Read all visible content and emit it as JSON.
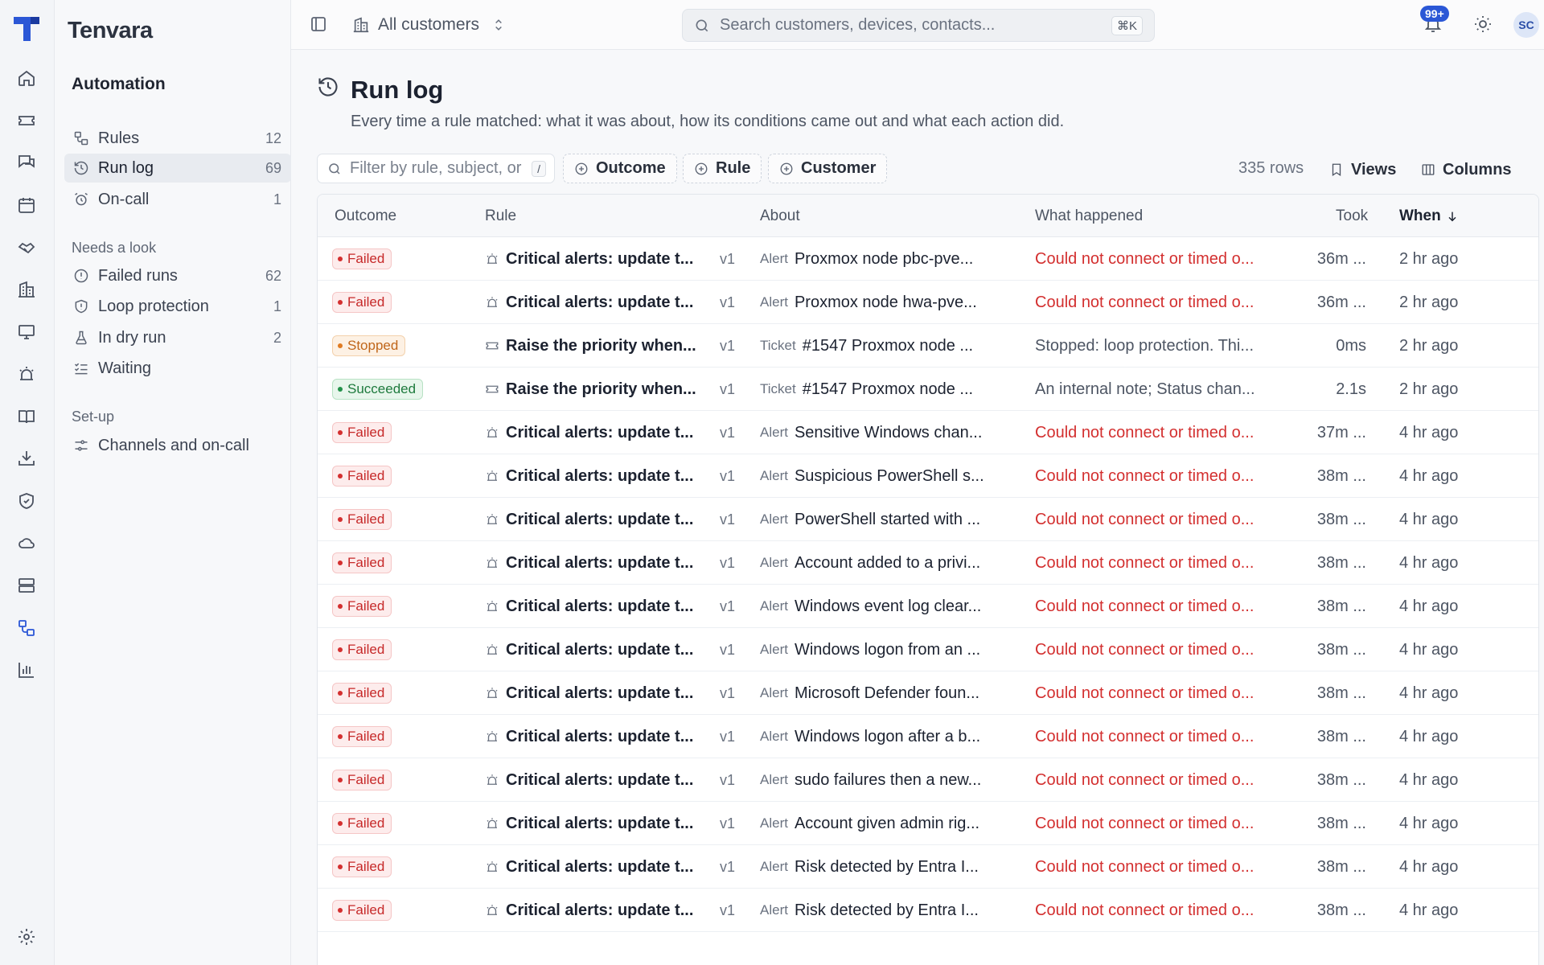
{
  "brand": "Tenvara",
  "sidebar": {
    "title": "Automation",
    "items": [
      {
        "label": "Rules",
        "count": "12",
        "icon": "rules-icon"
      },
      {
        "label": "Run log",
        "count": "69",
        "icon": "history-icon"
      },
      {
        "label": "On-call",
        "count": "1",
        "icon": "alarm-clock-icon"
      }
    ],
    "needs_look": {
      "title": "Needs a look",
      "items": [
        {
          "label": "Failed runs",
          "count": "62"
        },
        {
          "label": "Loop protection",
          "count": "1"
        },
        {
          "label": "In dry run",
          "count": "2"
        },
        {
          "label": "Waiting",
          "count": ""
        }
      ]
    },
    "setup": {
      "title": "Set-up",
      "items": [
        {
          "label": "Channels and on-call"
        }
      ]
    }
  },
  "topbar": {
    "scope": "All customers",
    "search_placeholder": "Search customers, devices, contacts...",
    "search_shortcut": "⌘K",
    "notifications": "99+",
    "avatar": "SC"
  },
  "page": {
    "title": "Run log",
    "subtitle": "Every time a rule matched: what it was about, how its conditions came out and what each action did.",
    "filter_placeholder": "Filter by rule, subject, or",
    "filter_shortcut": "/",
    "chips": [
      "Outcome",
      "Rule",
      "Customer"
    ],
    "rows_count": "335 rows",
    "views_label": "Views",
    "columns_label": "Columns"
  },
  "table": {
    "headers": {
      "outcome": "Outcome",
      "rule": "Rule",
      "about": "About",
      "happened": "What happened",
      "took": "Took",
      "when": "When"
    },
    "rows": [
      {
        "outcome": "Failed",
        "status": "failed",
        "rule": "Critical alerts: update t...",
        "rule_kind": "alert",
        "ver": "v1",
        "kind": "Alert",
        "about": "Proxmox node pbc-pve...",
        "happened": "Could not connect or timed o...",
        "took": "36m ...",
        "when": "2 hr ago"
      },
      {
        "outcome": "Failed",
        "status": "failed",
        "rule": "Critical alerts: update t...",
        "rule_kind": "alert",
        "ver": "v1",
        "kind": "Alert",
        "about": "Proxmox node hwa-pve...",
        "happened": "Could not connect or timed o...",
        "took": "36m ...",
        "when": "2 hr ago"
      },
      {
        "outcome": "Stopped",
        "status": "stopped",
        "rule": "Raise the priority when...",
        "rule_kind": "ticket",
        "ver": "v1",
        "kind": "Ticket",
        "about": "#1547 Proxmox node ...",
        "happened": "Stopped: loop protection. Thi...",
        "took": "0ms",
        "when": "2 hr ago"
      },
      {
        "outcome": "Succeeded",
        "status": "succeeded",
        "rule": "Raise the priority when...",
        "rule_kind": "ticket",
        "ver": "v1",
        "kind": "Ticket",
        "about": "#1547 Proxmox node ...",
        "happened": "An internal note; Status chan...",
        "took": "2.1s",
        "when": "2 hr ago"
      },
      {
        "outcome": "Failed",
        "status": "failed",
        "rule": "Critical alerts: update t...",
        "rule_kind": "alert",
        "ver": "v1",
        "kind": "Alert",
        "about": "Sensitive Windows chan...",
        "happened": "Could not connect or timed o...",
        "took": "37m ...",
        "when": "4 hr ago"
      },
      {
        "outcome": "Failed",
        "status": "failed",
        "rule": "Critical alerts: update t...",
        "rule_kind": "alert",
        "ver": "v1",
        "kind": "Alert",
        "about": "Suspicious PowerShell s...",
        "happened": "Could not connect or timed o...",
        "took": "38m ...",
        "when": "4 hr ago"
      },
      {
        "outcome": "Failed",
        "status": "failed",
        "rule": "Critical alerts: update t...",
        "rule_kind": "alert",
        "ver": "v1",
        "kind": "Alert",
        "about": "PowerShell started with ...",
        "happened": "Could not connect or timed o...",
        "took": "38m ...",
        "when": "4 hr ago"
      },
      {
        "outcome": "Failed",
        "status": "failed",
        "rule": "Critical alerts: update t...",
        "rule_kind": "alert",
        "ver": "v1",
        "kind": "Alert",
        "about": "Account added to a privi...",
        "happened": "Could not connect or timed o...",
        "took": "38m ...",
        "when": "4 hr ago"
      },
      {
        "outcome": "Failed",
        "status": "failed",
        "rule": "Critical alerts: update t...",
        "rule_kind": "alert",
        "ver": "v1",
        "kind": "Alert",
        "about": "Windows event log clear...",
        "happened": "Could not connect or timed o...",
        "took": "38m ...",
        "when": "4 hr ago"
      },
      {
        "outcome": "Failed",
        "status": "failed",
        "rule": "Critical alerts: update t...",
        "rule_kind": "alert",
        "ver": "v1",
        "kind": "Alert",
        "about": "Windows logon from an ...",
        "happened": "Could not connect or timed o...",
        "took": "38m ...",
        "when": "4 hr ago"
      },
      {
        "outcome": "Failed",
        "status": "failed",
        "rule": "Critical alerts: update t...",
        "rule_kind": "alert",
        "ver": "v1",
        "kind": "Alert",
        "about": "Microsoft Defender foun...",
        "happened": "Could not connect or timed o...",
        "took": "38m ...",
        "when": "4 hr ago"
      },
      {
        "outcome": "Failed",
        "status": "failed",
        "rule": "Critical alerts: update t...",
        "rule_kind": "alert",
        "ver": "v1",
        "kind": "Alert",
        "about": "Windows logon after a b...",
        "happened": "Could not connect or timed o...",
        "took": "38m ...",
        "when": "4 hr ago"
      },
      {
        "outcome": "Failed",
        "status": "failed",
        "rule": "Critical alerts: update t...",
        "rule_kind": "alert",
        "ver": "v1",
        "kind": "Alert",
        "about": "sudo failures then a new...",
        "happened": "Could not connect or timed o...",
        "took": "38m ...",
        "when": "4 hr ago"
      },
      {
        "outcome": "Failed",
        "status": "failed",
        "rule": "Critical alerts: update t...",
        "rule_kind": "alert",
        "ver": "v1",
        "kind": "Alert",
        "about": "Account given admin rig...",
        "happened": "Could not connect or timed o...",
        "took": "38m ...",
        "when": "4 hr ago"
      },
      {
        "outcome": "Failed",
        "status": "failed",
        "rule": "Critical alerts: update t...",
        "rule_kind": "alert",
        "ver": "v1",
        "kind": "Alert",
        "about": "Risk detected by Entra I...",
        "happened": "Could not connect or timed o...",
        "took": "38m ...",
        "when": "4 hr ago"
      },
      {
        "outcome": "Failed",
        "status": "failed",
        "rule": "Critical alerts: update t...",
        "rule_kind": "alert",
        "ver": "v1",
        "kind": "Alert",
        "about": "Risk detected by Entra I...",
        "happened": "Could not connect or timed o...",
        "took": "38m ...",
        "when": "4 hr ago"
      }
    ]
  },
  "colors": {
    "accent": "#2b57d6",
    "failed": "#d32f2f",
    "stopped": "#e07b22",
    "succeeded": "#23914a"
  }
}
